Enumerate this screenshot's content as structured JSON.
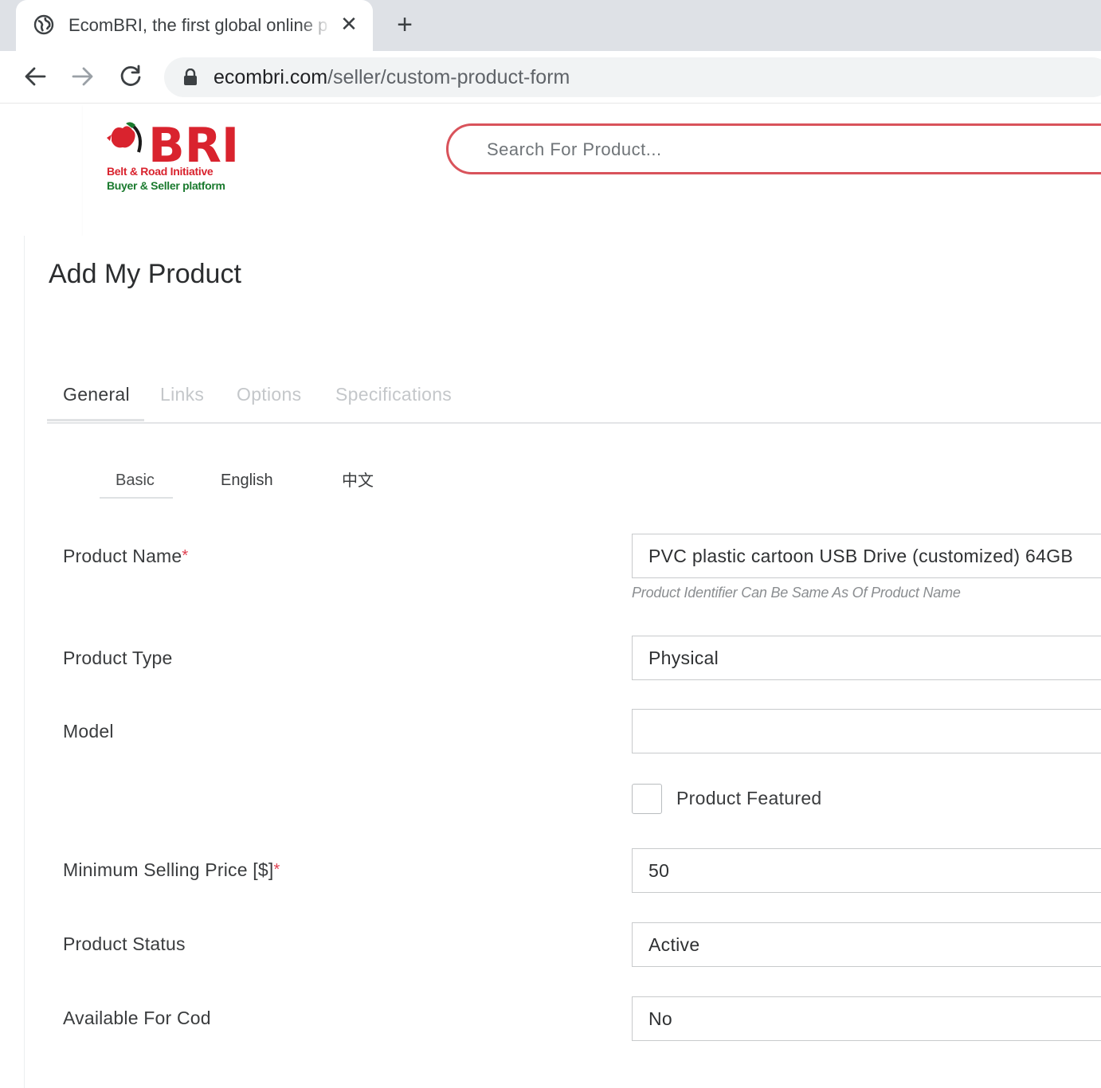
{
  "browser": {
    "tab_title": "EcomBRI, the first global online p",
    "close_glyph": "✕",
    "newtab_glyph": "+",
    "url_host": "ecombri.com",
    "url_path": "/seller/custom-product-form",
    "favicon": "globe-icon",
    "icons": [
      "back-arrow-icon",
      "forward-arrow-icon",
      "reload-icon",
      "lock-icon"
    ]
  },
  "header": {
    "logo_text": "BRI",
    "logo_line1": "Belt & Road Initiative",
    "logo_line2": "Buyer & Seller platform",
    "search_placeholder": "Search For Product...",
    "accent_color": "#d9535b"
  },
  "page": {
    "title": "Add My Product",
    "tabs": [
      {
        "label": "General",
        "active": true
      },
      {
        "label": "Links",
        "active": false
      },
      {
        "label": "Options",
        "active": false
      },
      {
        "label": "Specifications",
        "active": false
      }
    ],
    "subtabs": [
      {
        "label": "Basic",
        "active": true
      },
      {
        "label": "English",
        "active": false
      },
      {
        "label": "中文",
        "active": false
      }
    ]
  },
  "form": {
    "required_mark": "*",
    "product_name": {
      "label": "Product Name",
      "value": "PVC plastic cartoon USB Drive (customized) 64GB",
      "hint": "Product Identifier Can Be Same As Of Product Name"
    },
    "product_type": {
      "label": "Product Type",
      "value": "Physical"
    },
    "model": {
      "label": "Model",
      "value": ""
    },
    "featured": {
      "label": "Product Featured",
      "checked": false
    },
    "min_price": {
      "label": "Minimum Selling Price [$]",
      "value": "50"
    },
    "status": {
      "label": "Product Status",
      "value": "Active"
    },
    "cod": {
      "label": "Available For Cod",
      "value": "No"
    }
  }
}
